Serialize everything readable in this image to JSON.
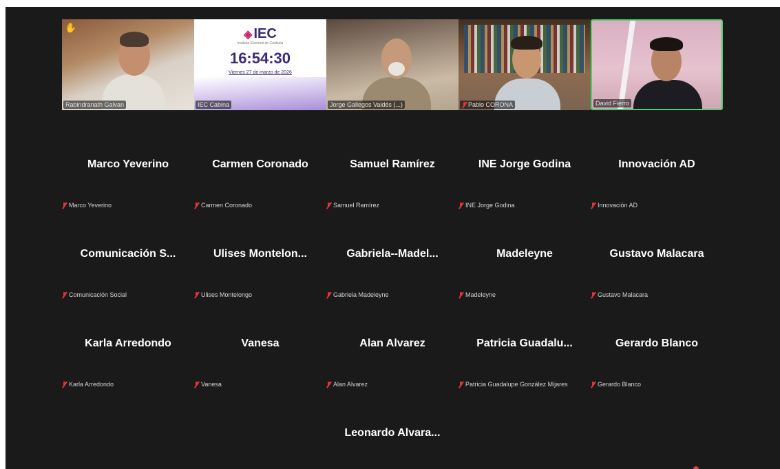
{
  "video_strip": [
    {
      "label": "Rabindranath Galvan",
      "raised_hand": true,
      "muted": false,
      "active": false
    },
    {
      "label": "IEC Cabina",
      "muted": false,
      "active": false,
      "slide": {
        "logo": "IEC",
        "subtitle": "Instituto Electoral de Coahuila",
        "time": "16:54:30",
        "date": "Viernes 27 de marzo de 2026"
      }
    },
    {
      "label": "Jorge Gallegos Valdés (...)",
      "muted": false,
      "active": false
    },
    {
      "label": "Pablo CORONA",
      "muted": true,
      "active": false
    },
    {
      "label": "David Fierro",
      "muted": false,
      "active": true
    }
  ],
  "participants": [
    {
      "display": "Marco Yeverino",
      "label": "Marco Yeverino"
    },
    {
      "display": "Carmen Coronado",
      "label": "Carmen Coronado"
    },
    {
      "display": "Samuel Ramírez",
      "label": "Samuel Ramírez"
    },
    {
      "display": "INE Jorge Godina",
      "label": "INE Jorge Godina"
    },
    {
      "display": "Innovación AD",
      "label": "Innovación AD"
    },
    {
      "display": "Comunicación S...",
      "label": "Comunicación Social"
    },
    {
      "display": "Ulises Montelon...",
      "label": "Ulises Montelongo"
    },
    {
      "display": "Gabriela--Madel...",
      "label": "Gabriela Madeleyne"
    },
    {
      "display": "Madeleyne",
      "label": "Madeleyne"
    },
    {
      "display": "Gustavo Malacara",
      "label": "Gustavo Malacara"
    },
    {
      "display": "Karla Arredondo",
      "label": "Karla Arredondo"
    },
    {
      "display": "Vanesa",
      "label": "Vanesa"
    },
    {
      "display": "Alan Alvarez",
      "label": "Alan Alvarez"
    },
    {
      "display": "Patricia Guadalu...",
      "label": "Patricia Guadalupe González Mijares"
    },
    {
      "display": "Gerardo Blanco",
      "label": "Gerardo Blanco"
    },
    {
      "display": "Leonardo Alvara...",
      "label": "Leonardo Alvarado"
    }
  ],
  "colors": {
    "active_speaker": "#4ccf6a",
    "muted_icon": "#e0353a",
    "background": "#1a1a1a"
  }
}
